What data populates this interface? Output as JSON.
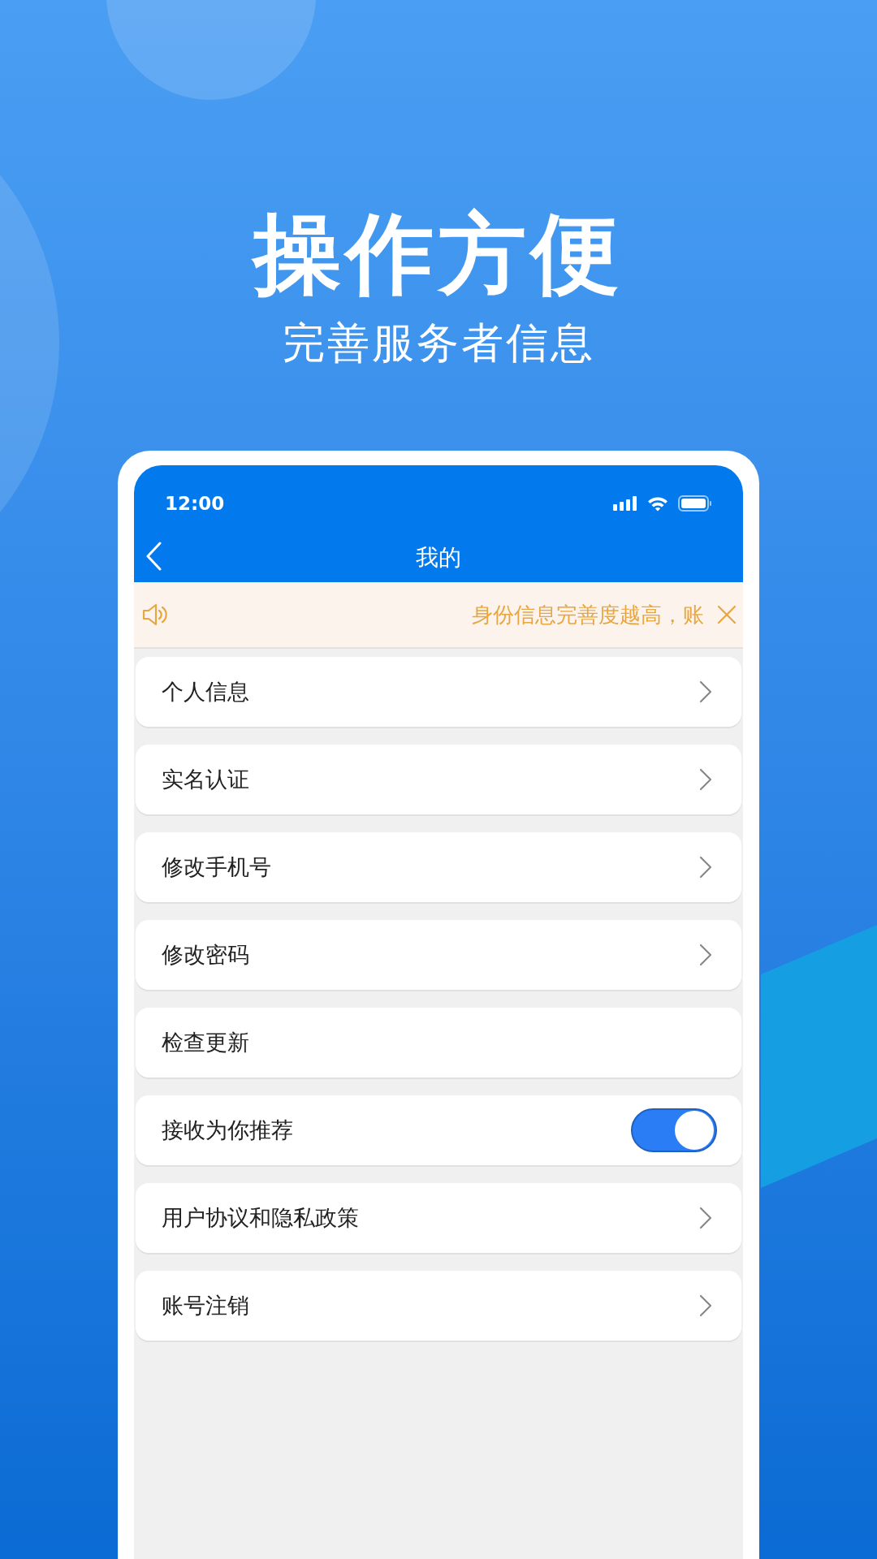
{
  "headline": "操作方便",
  "subheadline": "完善服务者信息",
  "phone": {
    "status_bar": {
      "time": "12:00"
    },
    "nav_bar": {
      "title": "我的"
    },
    "notice": {
      "text": "身份信息完善度越高，账"
    },
    "rows": [
      {
        "kind": "link",
        "label": "个人信息"
      },
      {
        "kind": "link",
        "label": "实名认证"
      },
      {
        "kind": "link",
        "label": "修改手机号"
      },
      {
        "kind": "link",
        "label": "修改密码"
      },
      {
        "kind": "plain",
        "label": "检查更新"
      },
      {
        "kind": "toggle",
        "label": "接收为你推荐",
        "on": true
      },
      {
        "kind": "link",
        "label": "用户协议和隐私政策"
      },
      {
        "kind": "link",
        "label": "账号注销"
      }
    ]
  }
}
